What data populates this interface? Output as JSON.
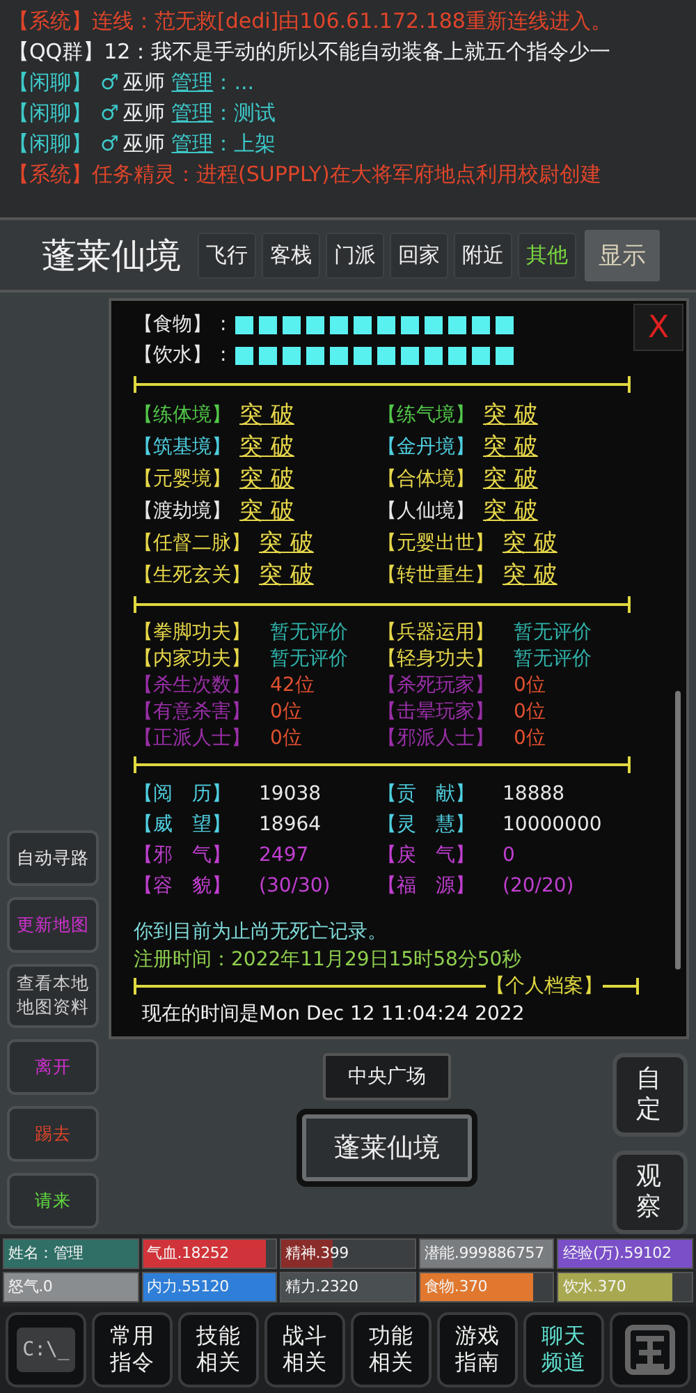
{
  "chat": [
    {
      "kind": "system",
      "channel": "【系统】",
      "text": "连线：范无救[dedi]由106.61.172.188重新连线进入。"
    },
    {
      "kind": "group",
      "channel": "【QQ群】",
      "text": "12：我不是手动的所以不能自动装备上就五个指令少一"
    },
    {
      "kind": "chat",
      "channel": "【闲聊】",
      "gender": "♂",
      "title": "巫师",
      "name": "管理",
      "text": "：..."
    },
    {
      "kind": "chat",
      "channel": "【闲聊】",
      "gender": "♂",
      "title": "巫师",
      "name": "管理",
      "text": "：测试"
    },
    {
      "kind": "chat",
      "channel": "【闲聊】",
      "gender": "♂",
      "title": "巫师",
      "name": "管理",
      "text": "：上架"
    },
    {
      "kind": "system",
      "channel": "【系统】",
      "text": "任务精灵：进程(SUPPLY)在大将军府地点利用校尉创建"
    }
  ],
  "header": {
    "title": "蓬莱仙境",
    "tabs": [
      {
        "label": "飞行",
        "selected": false
      },
      {
        "label": "客栈",
        "selected": false
      },
      {
        "label": "门派",
        "selected": false
      },
      {
        "label": "回家",
        "selected": false
      },
      {
        "label": "附近",
        "selected": false
      },
      {
        "label": "其他",
        "selected": true
      }
    ],
    "button": "显示"
  },
  "panel": {
    "close": "X",
    "meters": [
      {
        "label": "【食物】",
        "separator": ":"
      },
      {
        "label": "【饮水】",
        "separator": ":"
      }
    ],
    "realms": [
      {
        "label": "【练体境】",
        "color": "#52c84a",
        "action": "突 破"
      },
      {
        "label": "【练气境】",
        "color": "#52c84a",
        "action": "突 破"
      },
      {
        "label": "【筑基境】",
        "color": "#4fcfe0",
        "action": "突 破"
      },
      {
        "label": "【金丹境】",
        "color": "#4fcfe0",
        "action": "突 破"
      },
      {
        "label": "【元婴境】",
        "color": "#e8d84a",
        "action": "突 破"
      },
      {
        "label": "【合体境】",
        "color": "#e8d84a",
        "action": "突 破"
      },
      {
        "label": "【渡劫境】",
        "color": "#e8e8e8",
        "action": "突 破"
      },
      {
        "label": "【人仙境】",
        "color": "#e8e8e8",
        "action": "突 破"
      },
      {
        "label": "【任督二脉】",
        "color": "#e8d84a",
        "action": "突 破"
      },
      {
        "label": "【元婴出世】",
        "color": "#e8d84a",
        "action": "突 破"
      },
      {
        "label": "【生死玄关】",
        "color": "#e8d84a",
        "action": "突 破"
      },
      {
        "label": "【转世重生】",
        "color": "#e8d84a",
        "action": "突 破"
      }
    ],
    "ratings": [
      {
        "kind": "skill",
        "label": "【拳脚功夫】",
        "value": "暂无评价"
      },
      {
        "kind": "skill",
        "label": "【兵器运用】",
        "value": "暂无评价"
      },
      {
        "kind": "skill",
        "label": "【内家功夫】",
        "value": "暂无评价"
      },
      {
        "kind": "skill",
        "label": "【轻身功夫】",
        "value": "暂无评价"
      },
      {
        "kind": "record",
        "label": "【杀生次数】",
        "value": "42位"
      },
      {
        "kind": "record",
        "label": "【杀死玩家】",
        "value": "0位"
      },
      {
        "kind": "record",
        "label": "【有意杀害】",
        "value": "0位"
      },
      {
        "kind": "record",
        "label": "【击晕玩家】",
        "value": "0位"
      },
      {
        "kind": "record",
        "label": "【正派人士】",
        "value": "0位"
      },
      {
        "kind": "record",
        "label": "【邪派人士】",
        "value": "0位"
      }
    ],
    "attributes": [
      {
        "kind": "normal",
        "label": "【阅　历】",
        "value": "19038"
      },
      {
        "kind": "normal",
        "label": "【贡　献】",
        "value": "18888"
      },
      {
        "kind": "normal",
        "label": "【威　望】",
        "value": "18964"
      },
      {
        "kind": "normal",
        "label": "【灵　慧】",
        "value": "10000000"
      },
      {
        "kind": "aura",
        "label": "【邪　气】",
        "value": "2497"
      },
      {
        "kind": "aura",
        "label": "【戾　气】",
        "value": "0"
      },
      {
        "kind": "aura",
        "label": "【容　貌】",
        "value": "(30/30)"
      },
      {
        "kind": "aura",
        "label": "【福　源】",
        "value": "(20/20)"
      }
    ],
    "death_note": "你到目前为止尚无死亡记录。",
    "register_time": "注册时间：2022年11月29日15时58分50秒",
    "archive_label": "【个人档案】",
    "current_time": "现在的时间是Mon Dec 12 11:04:24 2022"
  },
  "sidebar": [
    {
      "label": "自动寻路",
      "color": "#e8e8e8"
    },
    {
      "label": "更新地图",
      "color": "#d030d0"
    },
    {
      "label": "查看本地地图资料",
      "color": "#cfcfcf"
    },
    {
      "label": "离开",
      "color": "#d030d0"
    },
    {
      "label": "踢去",
      "color": "#e0452a"
    },
    {
      "label": "请来",
      "color": "#5fd83f"
    }
  ],
  "exits": [
    "中央广场",
    "蓬莱仙境"
  ],
  "side_actions": [
    "自定",
    "观察"
  ],
  "status_bars": [
    {
      "label": "姓名：管理",
      "color": "#2f6f66",
      "level": 1
    },
    {
      "label": "气血.18252",
      "color": "#d0343a",
      "level": 0.93
    },
    {
      "label": "精神.399",
      "color": "#8a2d2a",
      "level": 0.38
    },
    {
      "label": "潜能.999886757",
      "color": "#7a7d80",
      "level": 1
    },
    {
      "label": "经验(万).59102",
      "color": "#7a4fc8",
      "level": 1
    },
    {
      "label": "怒气.0",
      "color": "#8a8d90",
      "level": 1
    },
    {
      "label": "内力.55120",
      "color": "#2f7fd8",
      "level": 1
    },
    {
      "label": "精力.2320",
      "color": "#4a4f52",
      "level": 1
    },
    {
      "label": "食物.370",
      "color": "#e0782f",
      "level": 0.85
    },
    {
      "label": "饮水.370",
      "color": "#a8a850",
      "level": 0.85
    }
  ],
  "toolbar": [
    {
      "kind": "terminal",
      "label": "C:\\_",
      "selected": false
    },
    {
      "kind": "text",
      "label": "常用指令",
      "selected": false
    },
    {
      "kind": "text",
      "label": "技能相关",
      "selected": false
    },
    {
      "kind": "text",
      "label": "战斗相关",
      "selected": false
    },
    {
      "kind": "text",
      "label": "功能相关",
      "selected": false
    },
    {
      "kind": "text",
      "label": "游戏指南",
      "selected": false
    },
    {
      "kind": "text",
      "label": "聊天频道",
      "selected": true
    },
    {
      "kind": "seal",
      "selected": false
    }
  ]
}
